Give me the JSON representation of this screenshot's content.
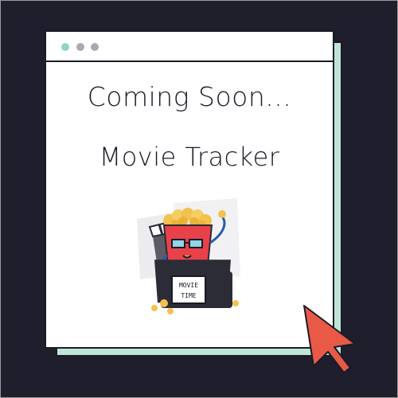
{
  "window": {
    "dots": [
      {
        "name": "window-dot-1",
        "color": "#8fd6c2"
      },
      {
        "name": "window-dot-2",
        "color": "#a9a9b3"
      },
      {
        "name": "window-dot-3",
        "color": "#a9a9b3"
      }
    ]
  },
  "content": {
    "headline": "Coming Soon...",
    "subtitle": "Movie Tracker"
  },
  "illustration": {
    "box_label_line1": "MOVIE",
    "box_label_line2": "TIME"
  },
  "colors": {
    "background": "#1e1e2c",
    "window": "#ffffff",
    "shadow_card": "#bfe5d9",
    "popcorn_bucket": "#e8414a",
    "popcorn": "#f3c24d",
    "cursor": "#e85a45"
  },
  "icons": {
    "cursor": "mouse-pointer-icon"
  }
}
